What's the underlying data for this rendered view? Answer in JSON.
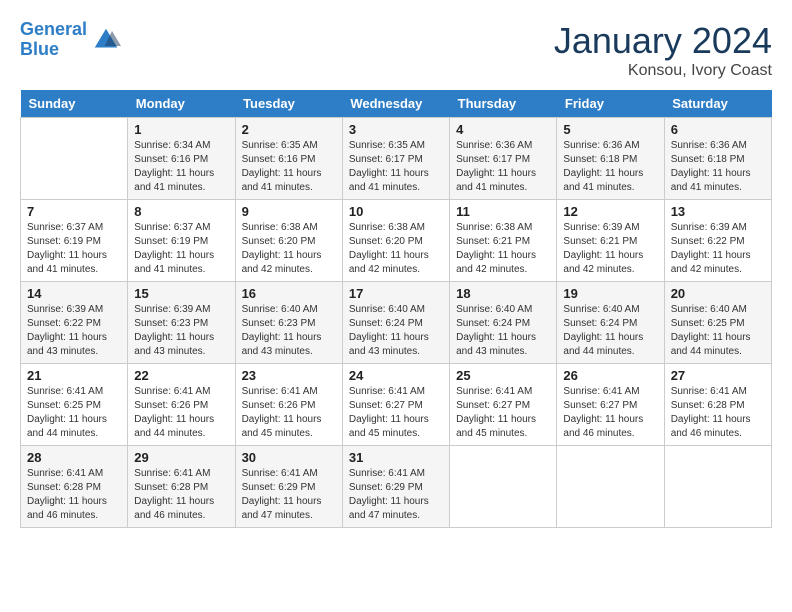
{
  "header": {
    "logo_line1": "General",
    "logo_line2": "Blue",
    "month": "January 2024",
    "location": "Konsou, Ivory Coast"
  },
  "weekdays": [
    "Sunday",
    "Monday",
    "Tuesday",
    "Wednesday",
    "Thursday",
    "Friday",
    "Saturday"
  ],
  "weeks": [
    [
      {
        "day": "",
        "info": ""
      },
      {
        "day": "1",
        "info": "Sunrise: 6:34 AM\nSunset: 6:16 PM\nDaylight: 11 hours\nand 41 minutes."
      },
      {
        "day": "2",
        "info": "Sunrise: 6:35 AM\nSunset: 6:16 PM\nDaylight: 11 hours\nand 41 minutes."
      },
      {
        "day": "3",
        "info": "Sunrise: 6:35 AM\nSunset: 6:17 PM\nDaylight: 11 hours\nand 41 minutes."
      },
      {
        "day": "4",
        "info": "Sunrise: 6:36 AM\nSunset: 6:17 PM\nDaylight: 11 hours\nand 41 minutes."
      },
      {
        "day": "5",
        "info": "Sunrise: 6:36 AM\nSunset: 6:18 PM\nDaylight: 11 hours\nand 41 minutes."
      },
      {
        "day": "6",
        "info": "Sunrise: 6:36 AM\nSunset: 6:18 PM\nDaylight: 11 hours\nand 41 minutes."
      }
    ],
    [
      {
        "day": "7",
        "info": "Sunrise: 6:37 AM\nSunset: 6:19 PM\nDaylight: 11 hours\nand 41 minutes."
      },
      {
        "day": "8",
        "info": "Sunrise: 6:37 AM\nSunset: 6:19 PM\nDaylight: 11 hours\nand 41 minutes."
      },
      {
        "day": "9",
        "info": "Sunrise: 6:38 AM\nSunset: 6:20 PM\nDaylight: 11 hours\nand 42 minutes."
      },
      {
        "day": "10",
        "info": "Sunrise: 6:38 AM\nSunset: 6:20 PM\nDaylight: 11 hours\nand 42 minutes."
      },
      {
        "day": "11",
        "info": "Sunrise: 6:38 AM\nSunset: 6:21 PM\nDaylight: 11 hours\nand 42 minutes."
      },
      {
        "day": "12",
        "info": "Sunrise: 6:39 AM\nSunset: 6:21 PM\nDaylight: 11 hours\nand 42 minutes."
      },
      {
        "day": "13",
        "info": "Sunrise: 6:39 AM\nSunset: 6:22 PM\nDaylight: 11 hours\nand 42 minutes."
      }
    ],
    [
      {
        "day": "14",
        "info": "Sunrise: 6:39 AM\nSunset: 6:22 PM\nDaylight: 11 hours\nand 43 minutes."
      },
      {
        "day": "15",
        "info": "Sunrise: 6:39 AM\nSunset: 6:23 PM\nDaylight: 11 hours\nand 43 minutes."
      },
      {
        "day": "16",
        "info": "Sunrise: 6:40 AM\nSunset: 6:23 PM\nDaylight: 11 hours\nand 43 minutes."
      },
      {
        "day": "17",
        "info": "Sunrise: 6:40 AM\nSunset: 6:24 PM\nDaylight: 11 hours\nand 43 minutes."
      },
      {
        "day": "18",
        "info": "Sunrise: 6:40 AM\nSunset: 6:24 PM\nDaylight: 11 hours\nand 43 minutes."
      },
      {
        "day": "19",
        "info": "Sunrise: 6:40 AM\nSunset: 6:24 PM\nDaylight: 11 hours\nand 44 minutes."
      },
      {
        "day": "20",
        "info": "Sunrise: 6:40 AM\nSunset: 6:25 PM\nDaylight: 11 hours\nand 44 minutes."
      }
    ],
    [
      {
        "day": "21",
        "info": "Sunrise: 6:41 AM\nSunset: 6:25 PM\nDaylight: 11 hours\nand 44 minutes."
      },
      {
        "day": "22",
        "info": "Sunrise: 6:41 AM\nSunset: 6:26 PM\nDaylight: 11 hours\nand 44 minutes."
      },
      {
        "day": "23",
        "info": "Sunrise: 6:41 AM\nSunset: 6:26 PM\nDaylight: 11 hours\nand 45 minutes."
      },
      {
        "day": "24",
        "info": "Sunrise: 6:41 AM\nSunset: 6:27 PM\nDaylight: 11 hours\nand 45 minutes."
      },
      {
        "day": "25",
        "info": "Sunrise: 6:41 AM\nSunset: 6:27 PM\nDaylight: 11 hours\nand 45 minutes."
      },
      {
        "day": "26",
        "info": "Sunrise: 6:41 AM\nSunset: 6:27 PM\nDaylight: 11 hours\nand 46 minutes."
      },
      {
        "day": "27",
        "info": "Sunrise: 6:41 AM\nSunset: 6:28 PM\nDaylight: 11 hours\nand 46 minutes."
      }
    ],
    [
      {
        "day": "28",
        "info": "Sunrise: 6:41 AM\nSunset: 6:28 PM\nDaylight: 11 hours\nand 46 minutes."
      },
      {
        "day": "29",
        "info": "Sunrise: 6:41 AM\nSunset: 6:28 PM\nDaylight: 11 hours\nand 46 minutes."
      },
      {
        "day": "30",
        "info": "Sunrise: 6:41 AM\nSunset: 6:29 PM\nDaylight: 11 hours\nand 47 minutes."
      },
      {
        "day": "31",
        "info": "Sunrise: 6:41 AM\nSunset: 6:29 PM\nDaylight: 11 hours\nand 47 minutes."
      },
      {
        "day": "",
        "info": ""
      },
      {
        "day": "",
        "info": ""
      },
      {
        "day": "",
        "info": ""
      }
    ]
  ]
}
